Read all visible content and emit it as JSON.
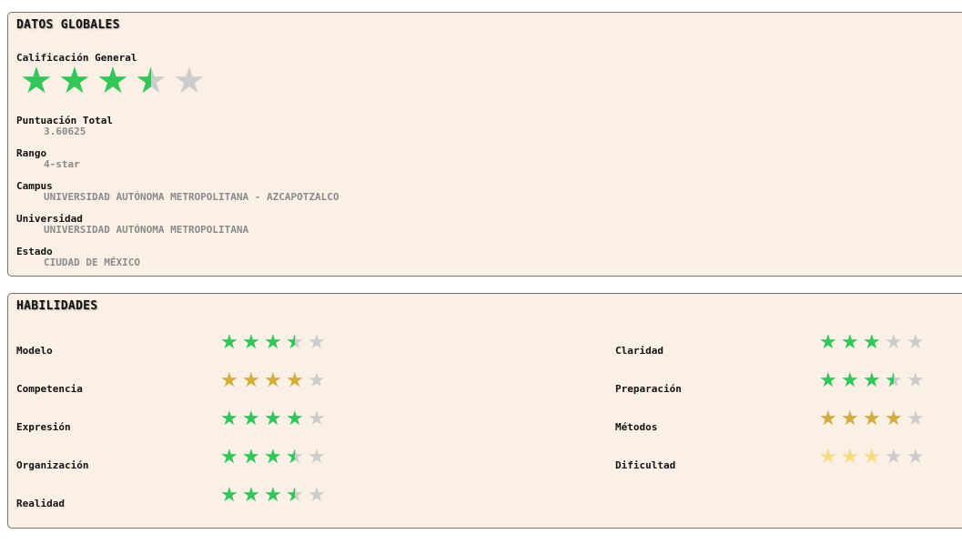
{
  "global": {
    "title": "DATOS GLOBALES",
    "rating_label": "Calificación General",
    "rating": 3.5,
    "rating_max": 5,
    "fields": [
      {
        "label": "Puntuación Total",
        "value": "3.60625"
      },
      {
        "label": "Rango",
        "value": "4-star"
      },
      {
        "label": "Campus",
        "value": "UNIVERSIDAD AUTÓNOMA METROPOLITANA - AZCAPOTZALCO"
      },
      {
        "label": "Universidad",
        "value": "UNIVERSIDAD AUTÓNOMA METROPOLITANA"
      },
      {
        "label": "Estado",
        "value": "CIUDAD DE MÉXICO"
      }
    ]
  },
  "skills": {
    "title": "HABILIDADES",
    "items": [
      {
        "label": "Modelo",
        "rating": 3.5,
        "color": "green"
      },
      {
        "label": "Competencia",
        "rating": 4,
        "color": "gold"
      },
      {
        "label": "Expresión",
        "rating": 4,
        "color": "green"
      },
      {
        "label": "Organización",
        "rating": 3.5,
        "color": "green"
      },
      {
        "label": "Realidad",
        "rating": 3.5,
        "color": "green"
      },
      {
        "label": "Claridad",
        "rating": 3,
        "color": "green"
      },
      {
        "label": "Preparación",
        "rating": 3.5,
        "color": "green"
      },
      {
        "label": "Métodos",
        "rating": 4,
        "color": "gold"
      },
      {
        "label": "Dificultad",
        "rating": 3,
        "color": "light-gold"
      }
    ]
  },
  "colors": {
    "green": "#33c659",
    "gold": "#d4ad3a",
    "light-gold": "#f7dc82",
    "empty": "#cccccc",
    "panel_bg": "#faf0e6"
  },
  "icons": {
    "star": "★"
  }
}
